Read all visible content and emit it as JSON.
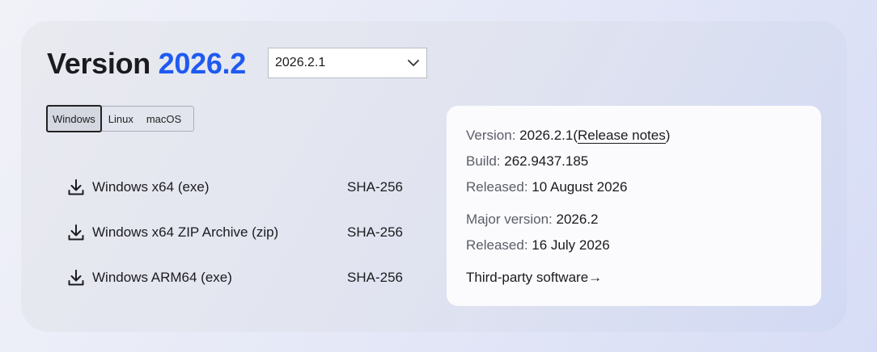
{
  "header": {
    "title_prefix": "Version",
    "title_version": "2026.2",
    "accent_color": "#1f5af0"
  },
  "version_select": {
    "selected": "2026.2.1",
    "icon": "chevron-down-icon"
  },
  "os_tabs": [
    {
      "label": "Windows",
      "active": true
    },
    {
      "label": "Linux",
      "active": false
    },
    {
      "label": "macOS",
      "active": false
    }
  ],
  "downloads": [
    {
      "label": "Windows x64 (exe)",
      "checksum": "SHA-256",
      "icon": "download-icon"
    },
    {
      "label": "Windows x64 ZIP Archive (zip)",
      "checksum": "SHA-256",
      "icon": "download-icon"
    },
    {
      "label": "Windows ARM64 (exe)",
      "checksum": "SHA-256",
      "icon": "download-icon"
    }
  ],
  "info": {
    "version_key": "Version:",
    "version_value": "2026.2.1",
    "release_notes_open": "(",
    "release_notes_label": "Release notes",
    "release_notes_close": ")",
    "build_key": "Build:",
    "build_value": "262.9437.185",
    "released_key": "Released:",
    "released_value": "10 August 2026",
    "major_key": "Major version:",
    "major_value": "2026.2",
    "major_released_key": "Released:",
    "major_released_value": "16 July 2026",
    "third_party_label": "Third-party software",
    "third_party_arrow": "→"
  }
}
